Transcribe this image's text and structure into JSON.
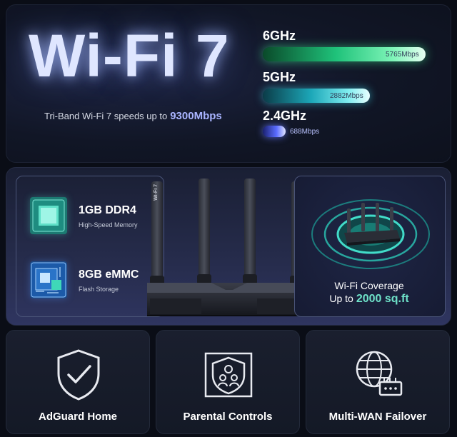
{
  "hero": {
    "title": "Wi-Fi 7",
    "subtitle": "Tri-Band Wi-Fi 7 speeds up to",
    "subtitle_highlight": "9300Mbps"
  },
  "bands": [
    {
      "label": "6GHz",
      "speed": "5765Mbps",
      "mbps": 5765,
      "color": "#2fd68a"
    },
    {
      "label": "5GHz",
      "speed": "2882Mbps",
      "mbps": 2882,
      "color": "#2fc4d2"
    },
    {
      "label": "2.4GHz",
      "speed": "688Mbps",
      "mbps": 688,
      "color": "#6a78ff"
    }
  ],
  "specs": [
    {
      "title": "1GB DDR4",
      "subtitle": "High-Speed Memory",
      "icon": "memory-chip-icon"
    },
    {
      "title": "8GB eMMC",
      "subtitle": "Flash Storage",
      "icon": "storage-chip-icon"
    }
  ],
  "router": {
    "brand_label": "Wi-Fi 7"
  },
  "coverage": {
    "line1": "Wi-Fi Coverage",
    "line2": "Up to",
    "highlight": "2000 sq.ft",
    "accent": "#6ee2c9"
  },
  "features": [
    {
      "label": "AdGuard Home",
      "icon": "shield-check-icon"
    },
    {
      "label": "Parental Controls",
      "icon": "parental-shield-icon"
    },
    {
      "label": "Multi-WAN Failover",
      "icon": "globe-network-icon"
    }
  ]
}
